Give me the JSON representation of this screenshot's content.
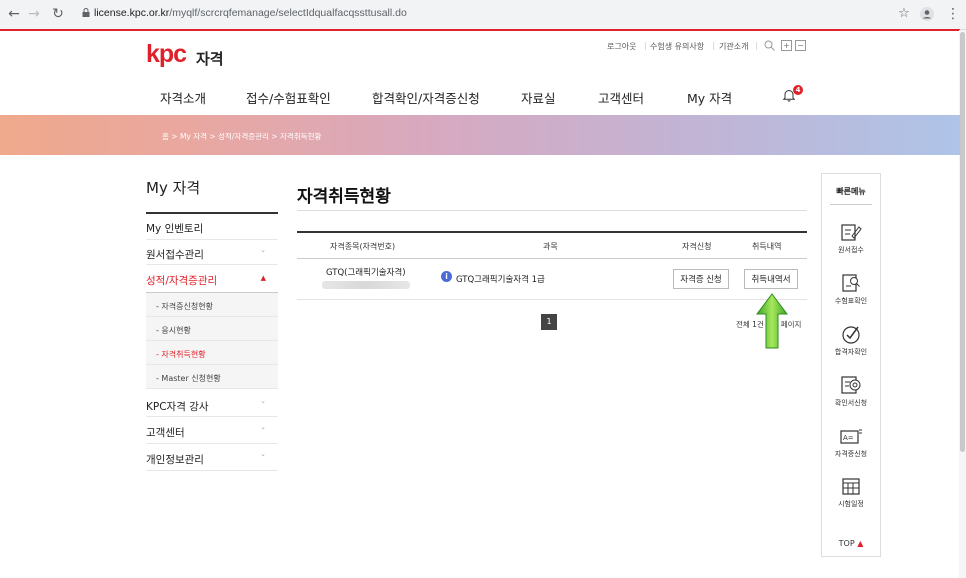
{
  "browser": {
    "url_host": "license.kpc.or.kr",
    "url_path": "/myqlf/scrcrqfemanage/selectIdqualfacqssttusall.do"
  },
  "header": {
    "logo_mark": "kpc",
    "logo_text": "자격",
    "util_links": [
      "로그아웃",
      "수험생 유의사항",
      "기관소개"
    ],
    "gnb": [
      "자격소개",
      "접수/수험표확인",
      "합격확인/자격증신청",
      "자료실",
      "고객센터",
      "My 자격"
    ],
    "notification_count": "4"
  },
  "breadcrumb": "홈 > My 자격 > 성적/자격증관리 > 자격취득현황",
  "sidebar": {
    "title": "My 자격",
    "items": [
      {
        "label": "My 인벤토리"
      },
      {
        "label": "원서접수관리"
      },
      {
        "label": "성적/자격증관리"
      },
      {
        "label": "KPC자격 강사"
      },
      {
        "label": "고객센터"
      },
      {
        "label": "개인정보관리"
      }
    ],
    "sub_items": [
      "- 자격증신청현황",
      "- 응시현황",
      "- 자격취득현황",
      "- Master 신청현황"
    ],
    "accent_color": "#e0212b"
  },
  "main": {
    "title": "자격취득현황",
    "table": {
      "headers": [
        "자격종목(자격번호)",
        "과목",
        "자격신청",
        "취득내역"
      ],
      "rows": [
        {
          "qualification": "GTQ(그래픽기술자격)",
          "subject": "GTQ그래픽기술자격 1급",
          "apply_btn": "자격증 신청",
          "history_btn": "취득내역서"
        }
      ]
    },
    "pagination": {
      "current_page": "1",
      "summary": "전체 1건 1/1 페이지"
    }
  },
  "quick_menu": {
    "title": "빠른메뉴",
    "items": [
      {
        "label": "원서접수",
        "icon": "form-pen-icon"
      },
      {
        "label": "수험표확인",
        "icon": "ticket-search-icon"
      },
      {
        "label": "합격자확인",
        "icon": "pass-check-icon"
      },
      {
        "label": "확인서신청",
        "icon": "certificate-stamp-icon"
      },
      {
        "label": "자격증신청",
        "icon": "id-card-icon"
      },
      {
        "label": "시험일정",
        "icon": "calendar-icon"
      }
    ],
    "top_label": "TOP"
  }
}
